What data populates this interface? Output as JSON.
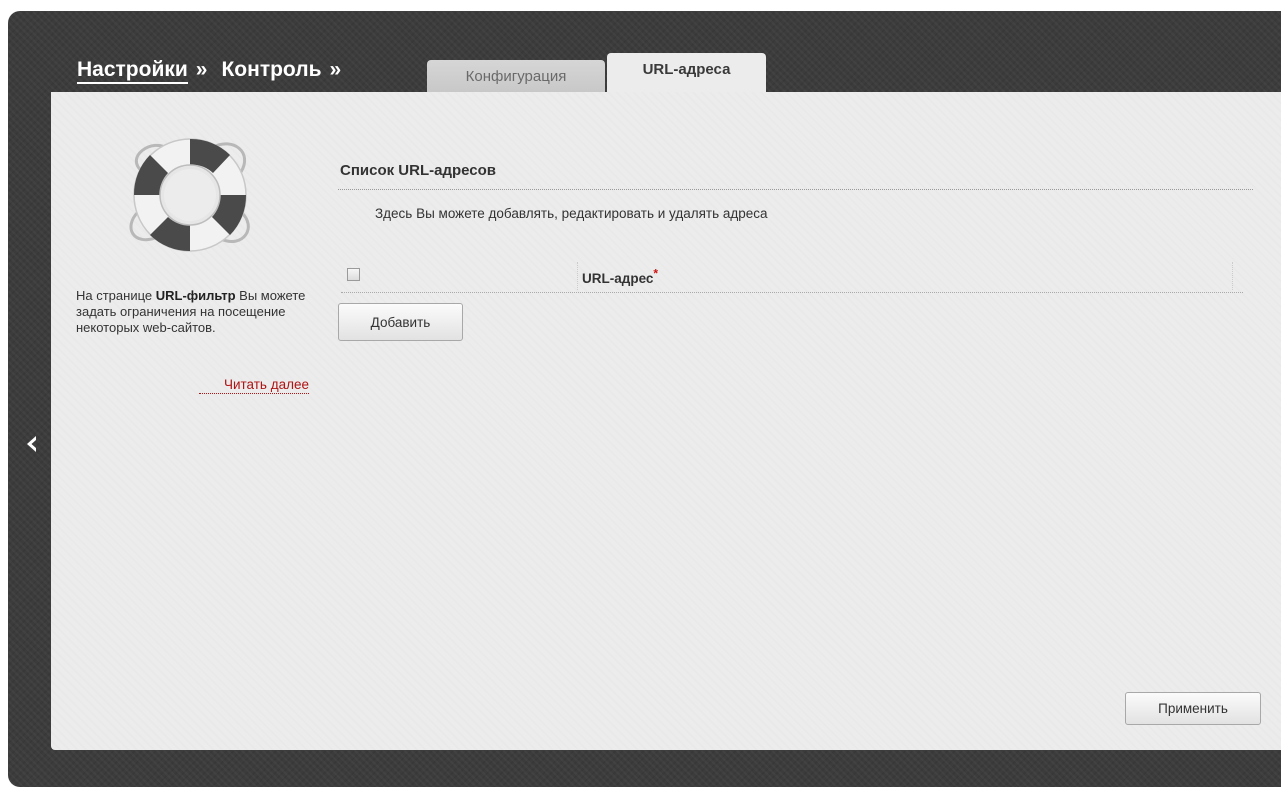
{
  "breadcrumb": {
    "settings": "Настройки",
    "sep1": "»",
    "control": "Контроль",
    "sep2": "»"
  },
  "tabs": [
    {
      "label": "Конфигурация",
      "active": false
    },
    {
      "label": "URL-адреса",
      "active": true
    }
  ],
  "sidebar": {
    "help_prefix": "На странице ",
    "help_bold": "URL-фильтр",
    "help_suffix": " Вы можете задать ограничения на посещение некоторых web-сайтов.",
    "read_more": "Читать далее",
    "icon": "lifebuoy-icon"
  },
  "section": {
    "title": "Список URL-адресов",
    "description": "Здесь Вы можете добавлять, редактировать и удалять адреса"
  },
  "table": {
    "columns": [
      {
        "label": "URL-адрес",
        "required_mark": "*"
      }
    ],
    "rows": []
  },
  "buttons": {
    "add": "Добавить",
    "apply": "Применить"
  },
  "nav": {
    "back_icon": "chevron-left-icon"
  },
  "colors": {
    "frame": "#3c3c3c",
    "panel": "#ececec",
    "link_red": "#b01313",
    "required": "#cc1111"
  }
}
